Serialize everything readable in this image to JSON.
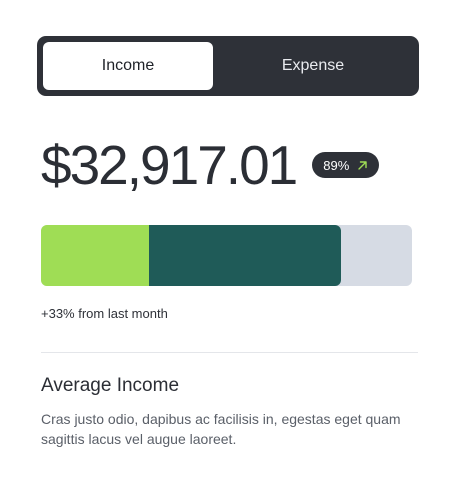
{
  "tabs": [
    {
      "label": "Income",
      "active": true
    },
    {
      "label": "Expense",
      "active": false
    }
  ],
  "summary": {
    "amount": "$32,917.01",
    "badge_text": "89%",
    "badge_icon": "arrow-up-right-icon",
    "change_text": "+33% from last month"
  },
  "progress": {
    "segments": [
      {
        "name": "income-share",
        "fraction": 0.29,
        "color": "#9fdd55"
      },
      {
        "name": "second-share",
        "fraction": 0.52,
        "color": "#1f5b58"
      }
    ],
    "track_color": "#d6dbe4"
  },
  "section": {
    "title": "Average Income",
    "body": "Cras justo odio, dapibus ac facilisis in, egestas eget quam sagittis lacus vel augue laoreet."
  },
  "colors": {
    "dark": "#2e3138",
    "accent_green": "#9fdd55",
    "deep_green": "#1f5b58"
  }
}
